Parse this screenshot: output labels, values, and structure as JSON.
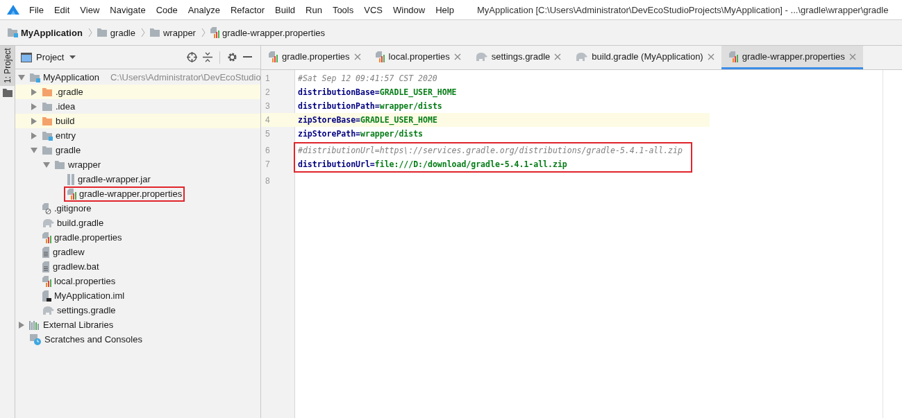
{
  "window": {
    "title": "MyApplication [C:\\Users\\Administrator\\DevEcoStudioProjects\\MyApplication] - ...\\gradle\\wrapper\\gradle"
  },
  "menu": [
    "File",
    "Edit",
    "View",
    "Navigate",
    "Code",
    "Analyze",
    "Refactor",
    "Build",
    "Run",
    "Tools",
    "VCS",
    "Window",
    "Help"
  ],
  "breadcrumbs": [
    {
      "label": "MyApplication",
      "kind": "project"
    },
    {
      "label": "gradle",
      "kind": "folder"
    },
    {
      "label": "wrapper",
      "kind": "folder"
    },
    {
      "label": "gradle-wrapper.properties",
      "kind": "properties"
    }
  ],
  "side_tab": {
    "label": "1: Project",
    "selected": true
  },
  "project_panel": {
    "title": "Project",
    "tree": [
      {
        "label": "MyApplication",
        "path": "C:\\Users\\Administrator\\DevEcoStudio",
        "kind": "project",
        "expanded": true,
        "boxed": false,
        "children": [
          {
            "label": ".gradle",
            "kind": "folder-excluded",
            "expanded": false,
            "boxed": false
          },
          {
            "label": ".idea",
            "kind": "folder",
            "expanded": false,
            "boxed": false
          },
          {
            "label": "build",
            "kind": "folder-excluded",
            "expanded": false,
            "boxed": false
          },
          {
            "label": "entry",
            "kind": "module",
            "expanded": false,
            "boxed": false
          },
          {
            "label": "gradle",
            "kind": "folder",
            "expanded": true,
            "boxed": false,
            "children": [
              {
                "label": "wrapper",
                "kind": "folder",
                "expanded": true,
                "boxed": false,
                "children": [
                  {
                    "label": "gradle-wrapper.jar",
                    "kind": "jar",
                    "boxed": false
                  },
                  {
                    "label": "gradle-wrapper.properties",
                    "kind": "properties",
                    "boxed": true
                  }
                ]
              }
            ]
          },
          {
            "label": ".gitignore",
            "kind": "ignore",
            "boxed": false
          },
          {
            "label": "build.gradle",
            "kind": "gradle",
            "boxed": false
          },
          {
            "label": "gradle.properties",
            "kind": "properties",
            "boxed": false
          },
          {
            "label": "gradlew",
            "kind": "text",
            "boxed": false
          },
          {
            "label": "gradlew.bat",
            "kind": "text",
            "boxed": false
          },
          {
            "label": "local.properties",
            "kind": "properties",
            "boxed": false
          },
          {
            "label": "MyApplication.iml",
            "kind": "iml",
            "boxed": false
          },
          {
            "label": "settings.gradle",
            "kind": "gradle",
            "boxed": false
          }
        ]
      },
      {
        "label": "External Libraries",
        "kind": "libraries",
        "expanded": false,
        "boxed": false
      },
      {
        "label": "Scratches and Consoles",
        "kind": "scratches",
        "boxed": false
      }
    ]
  },
  "tabs": [
    {
      "label": "gradle.properties",
      "kind": "properties",
      "selected": false
    },
    {
      "label": "local.properties",
      "kind": "properties",
      "selected": false
    },
    {
      "label": "settings.gradle",
      "kind": "gradle",
      "selected": false
    },
    {
      "label": "build.gradle (MyApplication)",
      "kind": "gradle",
      "selected": false
    },
    {
      "label": "gradle-wrapper.properties",
      "kind": "properties",
      "selected": true
    }
  ],
  "editor": {
    "lines": [
      {
        "number": "1",
        "kind": "comment",
        "text": "#Sat Sep 12 09:41:57 CST 2020",
        "current": false,
        "boxed": false
      },
      {
        "number": "2",
        "kind": "property",
        "key": "distributionBase",
        "sep": "=",
        "value": "GRADLE_USER_HOME",
        "current": false,
        "boxed": false
      },
      {
        "number": "3",
        "kind": "property",
        "key": "distributionPath",
        "sep": "=",
        "value": "wrapper/dists",
        "current": false,
        "boxed": false
      },
      {
        "number": "4",
        "kind": "property",
        "key": "zipStoreBase",
        "sep": "=",
        "value": "GRADLE_USER_HOME",
        "current": true,
        "boxed": false
      },
      {
        "number": "5",
        "kind": "property",
        "key": "zipStorePath",
        "sep": "=",
        "value": "wrapper/dists",
        "current": false,
        "boxed": false
      },
      {
        "number": "6",
        "kind": "comment",
        "text": "#distributionUrl=https\\://services.gradle.org/distributions/gradle-5.4.1-all.zip",
        "current": false,
        "boxed": true
      },
      {
        "number": "7",
        "kind": "property",
        "key": "distributionUrl",
        "sep": "=",
        "value": "file:///D:/download/gradle-5.4.1-all.zip",
        "current": false,
        "boxed": true
      },
      {
        "number": "8",
        "kind": "empty",
        "current": false,
        "boxed": false
      }
    ]
  }
}
